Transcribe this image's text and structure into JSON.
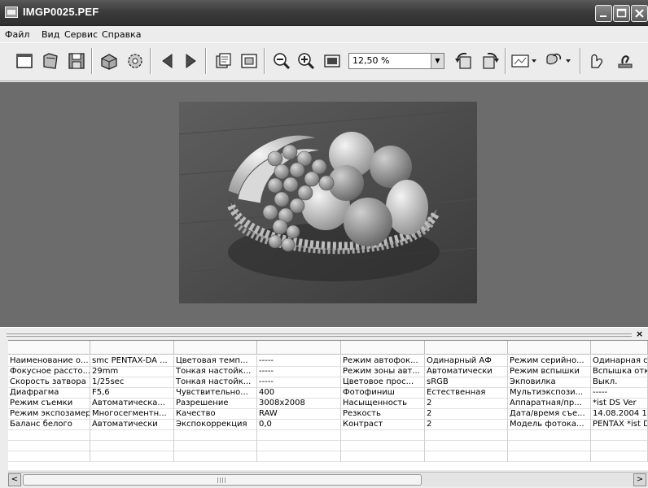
{
  "window": {
    "title": "IMGP0025.PEF",
    "controls": [
      "_",
      "□",
      "X"
    ]
  },
  "menu": [
    "Файл",
    "Вид",
    "Сервис",
    "Справка"
  ],
  "toolbar": {
    "zoom_value": "12,50 %"
  },
  "colors": {
    "titlebar": "#3c3c3c",
    "viewer_bg": "#6c6c6c",
    "panel_bg": "#ececec"
  },
  "icons": [
    "new-window-icon",
    "open-icon",
    "save-icon",
    "print-icon",
    "settings-icon",
    "previous-icon",
    "next-icon",
    "copy-icon",
    "fit-window-icon",
    "zoom-out-icon",
    "zoom-in-icon",
    "actual-size-icon",
    "rotate-left-icon",
    "rotate-right-icon",
    "compare-icon",
    "batch-icon",
    "help-icon",
    "about-icon"
  ],
  "info_table": {
    "rows": [
      [
        "Наименование о...",
        "smc PENTAX-DA ...",
        "Цветовая темп...",
        "-----",
        "Режим автофок...",
        "Одинарный АФ",
        "Режим серийно...",
        "Одинарная с"
      ],
      [
        "Фокусное рассто...",
        "29mm",
        "Тонкая настойк...",
        "-----",
        "Режим зоны авт...",
        "Автоматически",
        "Режим вспышки",
        "Вспышка отк"
      ],
      [
        "Скорость затвора",
        "1/25sec",
        "Тонкая настойк...",
        "-----",
        "Цветовое прос...",
        "sRGB",
        "Экповилка",
        "Выкл."
      ],
      [
        "Диафрагма",
        "F5,6",
        "Чувствительно...",
        "400",
        "Фотофиниш",
        "Естественная",
        "Мультиэкспози...",
        "-----"
      ],
      [
        "Режим съемки",
        "Автоматическа...",
        "Разрешение",
        "3008x2008",
        "Насыщенность",
        "2",
        "Аппаратная/пр...",
        "*ist DS  Ver"
      ],
      [
        "Режим экспозамера",
        "Многосегментн...",
        "Качество",
        "RAW",
        "Резкость",
        "2",
        "Дата/время съе...",
        "14.08.2004 1"
      ],
      [
        "Баланс белого",
        "Автоматически",
        "Экспокоррекция",
        "0,0",
        "Контраст",
        "2",
        "Модель фотока...",
        "PENTAX *ist D"
      ]
    ]
  }
}
